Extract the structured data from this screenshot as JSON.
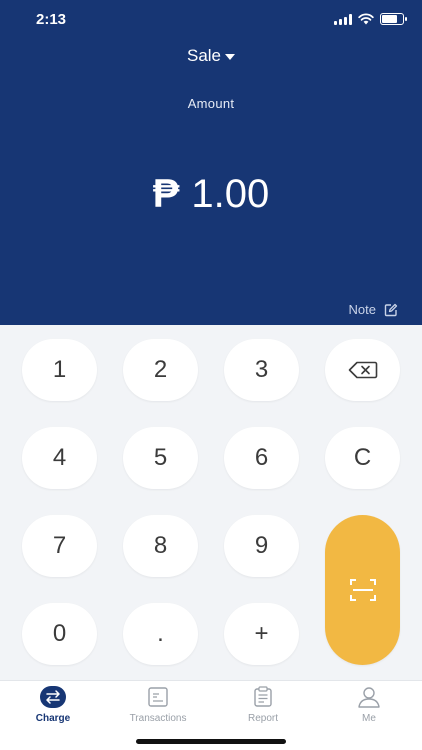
{
  "status_bar": {
    "time": "2:13",
    "icons": [
      "signal-icon",
      "wifi-icon",
      "battery-icon"
    ]
  },
  "header": {
    "mode": "Sale",
    "amount_label": "Amount",
    "currency": "₱",
    "amount": "1.00",
    "note_label": "Note",
    "background": "#173674"
  },
  "keypad": {
    "keys": [
      "1",
      "2",
      "3",
      "4",
      "5",
      "6",
      "7",
      "8",
      "9",
      "0",
      ".",
      "+"
    ],
    "clear_label": "C",
    "backspace_icon": "backspace-icon",
    "scan_icon": "scan-icon",
    "scan_color": "#f2b843"
  },
  "tabs": [
    {
      "label": "Charge",
      "icon": "charge-icon",
      "active": true
    },
    {
      "label": "Transactions",
      "icon": "transactions-icon",
      "active": false
    },
    {
      "label": "Report",
      "icon": "report-icon",
      "active": false
    },
    {
      "label": "Me",
      "icon": "profile-icon",
      "active": false
    }
  ]
}
